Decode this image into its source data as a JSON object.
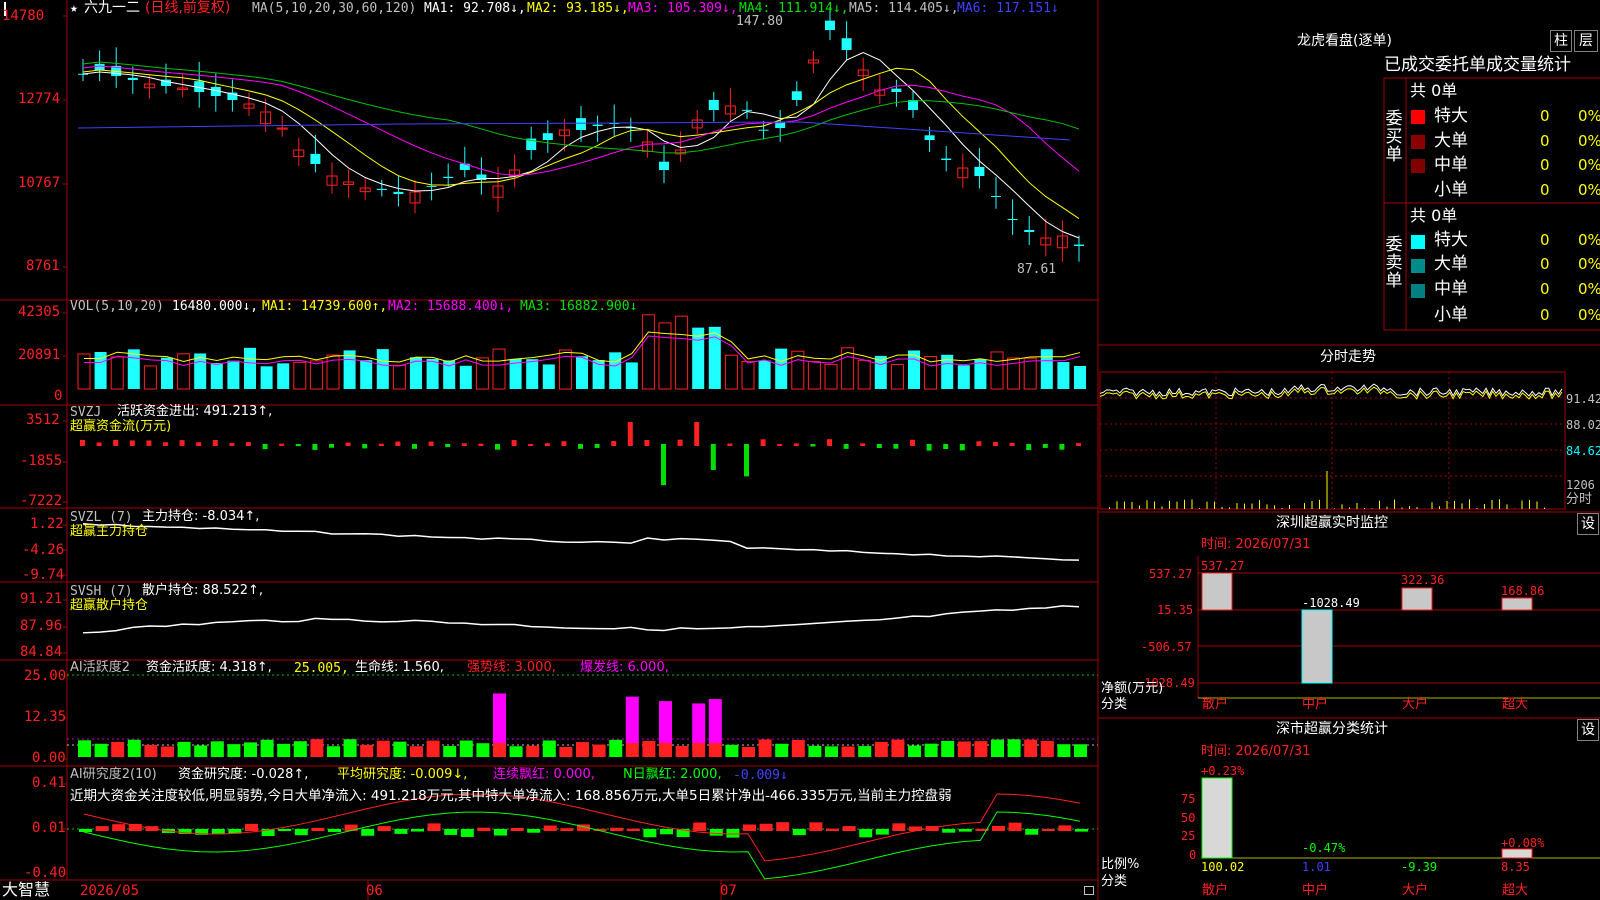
{
  "colors": {
    "up": "#ff2020",
    "down": "#20ffff",
    "grid": "#a00000",
    "white": "#ffffff",
    "yellow": "#ffff00",
    "magenta": "#ff00ff",
    "green": "#00c000",
    "blue": "#4040ff"
  },
  "main": {
    "yaxis": [
      "14780",
      "12774",
      "10767",
      "8761"
    ],
    "title_star": "★",
    "title_name": "六九一二",
    "title_mode": "(日线,前复权)",
    "ma_header": "MA(5,10,20,30,60,120)",
    "ma1": "MA1: 92.708↓,",
    "ma2": "MA2: 93.185↓,",
    "ma3": "MA3: 105.309↓,",
    "ma4": "MA4: 111.914↓,",
    "ma5": "MA5: 114.405↓,",
    "ma6": "MA6: 117.151↓",
    "high_label": "147.80",
    "low_label": "87.61"
  },
  "vol": {
    "yaxis": [
      "42305",
      "20891",
      "0"
    ],
    "header": "VOL(5,10,20)",
    "v": "16480.000↓,",
    "ma1": "MA1: 14739.600↑,",
    "ma2": "MA2: 15688.400↓,",
    "ma3": "MA3: 16882.900↓"
  },
  "svzj": {
    "yaxis": [
      "3512",
      "-1855",
      "-7222"
    ],
    "header": "SVZJ",
    "value": "活跃资金进出: 491.213↑,",
    "sub": "超赢资金流(万元)"
  },
  "svzl": {
    "yaxis": [
      "1.22",
      "-4.26",
      "-9.74"
    ],
    "header": "SVZL (7)",
    "value": "主力持仓: -8.034↑,",
    "sub": "超赢主力持仓"
  },
  "svsh": {
    "yaxis": [
      "91.21",
      "87.96",
      "84.84"
    ],
    "header": "SVSH (7)",
    "value": "散户持仓: 88.522↑,",
    "sub": "超赢散户持仓"
  },
  "ai1": {
    "yaxis": [
      "25.00",
      "12.35",
      "0.00"
    ],
    "header": "AI活跃度2",
    "a": "资金活跃度: 4.318↑,",
    "b": "25.005,",
    "c": "生命线: 1.560,",
    "d": "强势线: 3.000,",
    "e": "爆发线: 6.000,"
  },
  "ai2": {
    "yaxis": [
      "0.41",
      "0.01",
      "-0.40"
    ],
    "header": "AI研究度2(10)",
    "a": "资金研究度: -0.028↑,",
    "b": "平均研究度: -0.009↓,",
    "c": "连续飘红: 0.000,",
    "d": "N日飘红: 2.000,",
    "e": "-0.009↓",
    "comment": "近期大资金关注度较低,明显弱势,今日大单净流入: 491.218万元,其中特大单净流入: 168.856万元,大单5日累计净出-466.335万元,当前主力控盘弱"
  },
  "xaxis": {
    "brand": "大智慧",
    "d1": "2026/05",
    "d2": "06",
    "d3": "07"
  },
  "right": {
    "lhb_title": "龙虎看盘(逐单)",
    "btn_bar": "柱",
    "btn_grid": "层",
    "tab_label": "已成交委托单成交量统计",
    "buy_side": "委买单",
    "sell_side": "委卖单",
    "total_buy": "共 0单",
    "total_sell": "共 0单",
    "rows": [
      {
        "label": "特大",
        "val": "0",
        "pct": "0%"
      },
      {
        "label": "大单",
        "val": "0",
        "pct": "0%"
      },
      {
        "label": "中单",
        "val": "0",
        "pct": "0%"
      },
      {
        "label": "小单",
        "val": "0",
        "pct": "0%"
      }
    ],
    "fs_title": "分时走势",
    "fs_y": [
      "91.42",
      "88.02",
      "84.62",
      "1206",
      "分时"
    ],
    "sz_title": "深圳超赢实时监控",
    "sz_btn": "设",
    "sz_time": "时间: 2026/07/31",
    "sz_y": [
      "537.27",
      "15.35",
      "-506.57",
      "-1028.49"
    ],
    "sz_vals": [
      "537.27",
      "-1028.49",
      "322.36",
      "168.86"
    ],
    "sz_ylabel": "净额(万元)",
    "sz_xlabel": "分类",
    "cats": [
      "散户",
      "中户",
      "大户",
      "超大"
    ],
    "fl_title": "深市超赢分类统计",
    "fl_btn": "设",
    "fl_time": "时间: 2026/07/31",
    "fl_y": [
      "75",
      "50",
      "25",
      "0"
    ],
    "fl_top": [
      "+0.23%",
      "-0.47%",
      "+0.08%"
    ],
    "fl_bottom": [
      "100.02",
      "1.01",
      "-9.39",
      "8.35"
    ],
    "fl_ylabel": "比例%",
    "fl_xlabel": "分类"
  }
}
